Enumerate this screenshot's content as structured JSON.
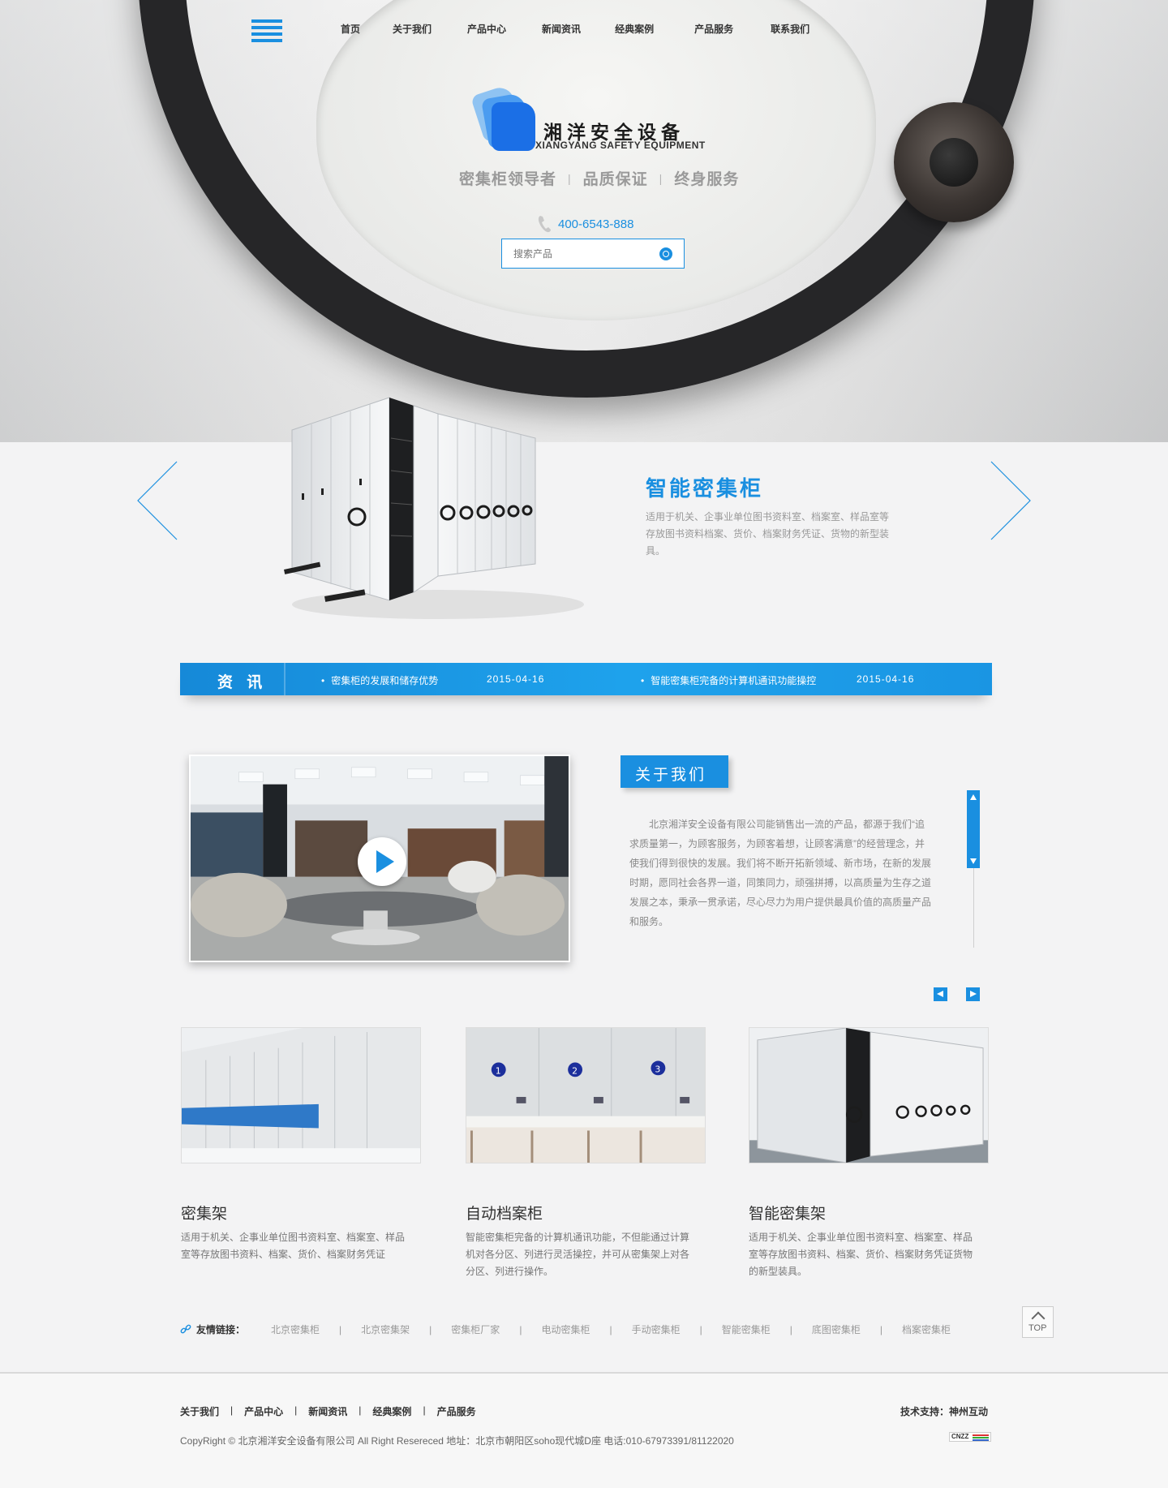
{
  "header": {
    "nav": [
      "首页",
      "关于我们",
      "产品中心",
      "新闻资讯",
      "经典案例",
      "产品服务",
      "联系我们"
    ],
    "logo_cn": "湘洋安全设备",
    "logo_en": "XIANGYANG SAFETY EQUIPMENT",
    "slogans": [
      "密集柜领导者",
      "品质保证",
      "终身服务"
    ],
    "phone": "400-6543-888",
    "search_placeholder": "搜索产品"
  },
  "slider": {
    "title": "智能密集柜",
    "desc": "适用于机关、企事业单位图书资料室、档案室、样品室等存放图书资料档案、货价、档案财务凭证、货物的新型装具。"
  },
  "news": {
    "label": "资 讯",
    "items": [
      {
        "title": "密集柜的发展和储存优势",
        "date": "2015-04-16"
      },
      {
        "title": "智能密集柜完备的计算机通讯功能操控",
        "date": "2015-04-16"
      }
    ]
  },
  "about": {
    "label": "关于我们",
    "text": "北京湘洋安全设备有限公司能销售出一流的产品，都源于我们“追求质量第一，为顾客服务，为顾客着想，让顾客满意”的经营理念，并使我们得到很快的发展。我们将不断开拓新领域、新市场，在新的发展时期，愿同社会各界一道，同策同力，顽强拼搏，以高质量为生存之道发展之本，秉承一贯承诺，尽心尽力为用户提供最具价值的高质量产品和服务。"
  },
  "products": [
    {
      "title": "密集架",
      "desc": "适用于机关、企事业单位图书资料室、档案室、样品室等存放图书资料、档案、货价、档案财务凭证"
    },
    {
      "title": "自动档案柜",
      "desc": "智能密集柜完备的计算机通讯功能，不但能通过计算机对各分区、列进行灵活操控，并可从密集架上对各分区、列进行操作。"
    },
    {
      "title": "智能密集架",
      "desc": "适用于机关、企事业单位图书资料室、档案室、样品室等存放图书资料、档案、货价、档案财务凭证货物的新型装具。"
    }
  ],
  "links": {
    "label": "友情链接：",
    "items": [
      "北京密集柜",
      "北京密集架",
      "密集柜厂家",
      "电动密集柜",
      "手动密集柜",
      "智能密集柜",
      "底图密集柜",
      "档案密集柜"
    ]
  },
  "top_label": "TOP",
  "footer": {
    "nav": [
      "关于我们",
      "产品中心",
      "新闻资讯",
      "经典案例",
      "产品服务"
    ],
    "support": "技术支持：神州互动",
    "copyright": "CopyRight © 北京湘洋安全设备有限公司  All Right Resereced  地址：北京市朝阳区soho现代城D座  电话:010-67973391/81122020",
    "badge": "CNZZ"
  },
  "colors": {
    "accent": "#1a8fe0",
    "wheel": "#262628"
  }
}
